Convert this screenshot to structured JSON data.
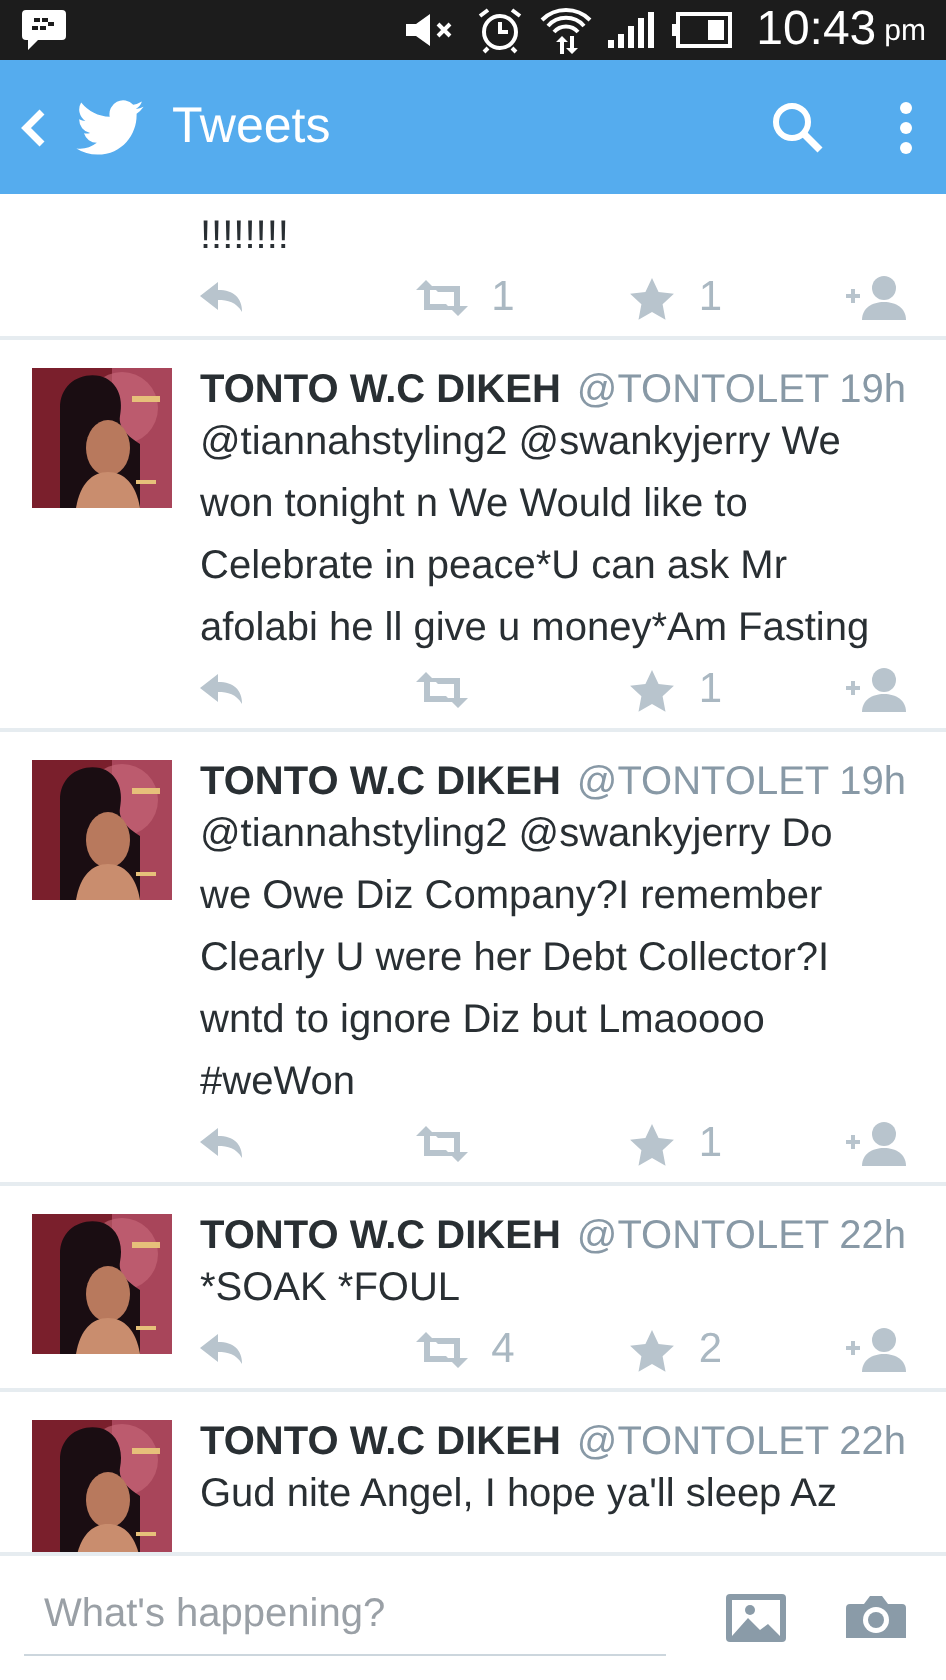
{
  "status_bar": {
    "time": "10:43",
    "period": "pm"
  },
  "app_bar": {
    "title": "Tweets"
  },
  "tweets": [
    {
      "partial": true,
      "text": "!!!!!!!!",
      "retweets": "1",
      "favorites": "1"
    },
    {
      "partial": false,
      "name": "TONTO W.C DIKEH",
      "handle": "@TONTOLET",
      "time": "19h",
      "text": "@tiannahstyling2 @swankyjerry We won tonight n We Would like to Celebrate in peace*U can ask Mr afolabi he ll give u money*Am Fasting",
      "favorites": "1"
    },
    {
      "partial": false,
      "name": "TONTO W.C DIKEH",
      "handle": "@TONTOLET",
      "time": "19h",
      "text": "@tiannahstyling2 @swankyjerry Do we Owe Diz Company?I remember Clearly U were her Debt Collector?I wntd to ignore Diz but Lmaoooo #weWon",
      "favorites": "1"
    },
    {
      "partial": false,
      "name": "TONTO W.C DIKEH",
      "handle": "@TONTOLET",
      "time": "22h",
      "text": "*SOAK *FOUL",
      "retweets": "4",
      "favorites": "2"
    },
    {
      "partial": false,
      "name": "TONTO W.C DIKEH",
      "handle": "@TONTOLET",
      "time": "22h",
      "text": "Gud nite Angel, I hope ya'll sleep Az",
      "cut": true
    }
  ],
  "compose": {
    "placeholder": "What's happening?"
  }
}
